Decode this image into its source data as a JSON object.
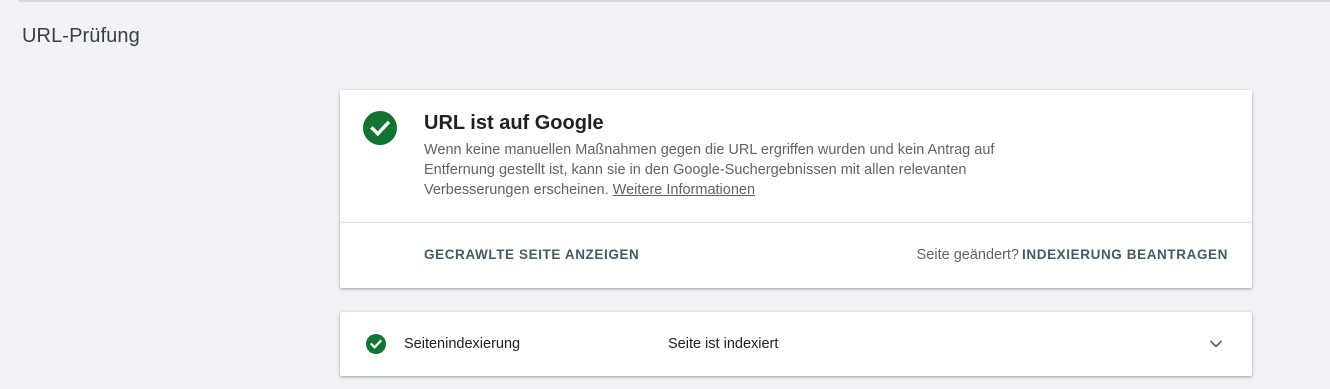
{
  "page": {
    "title": "URL-Prüfung"
  },
  "status_card": {
    "icon": "check-circle-icon",
    "title": "URL ist auf Google",
    "description": "Wenn keine manuellen Maßnahmen gegen die URL ergriffen wurden und kein Antrag auf Entfernung gestellt ist, kann sie in den Google-Suchergebnissen mit allen relevanten Verbesserungen erscheinen.",
    "more_info_link": "Weitere Informationen",
    "crawled_page_button": "GECRAWLTE SEITE ANZEIGEN",
    "page_changed_label": "Seite geändert?",
    "request_indexing_button": "INDEXIERUNG BEANTRAGEN"
  },
  "indexing_card": {
    "icon": "check-circle-icon",
    "label": "Seitenindexierung",
    "value": "Seite ist indexiert",
    "expand_icon": "chevron-down-icon"
  },
  "colors": {
    "background": "#f1f3f7",
    "success_green": "#137333",
    "action_text": "#455a64",
    "secondary_text": "#5f6368"
  }
}
